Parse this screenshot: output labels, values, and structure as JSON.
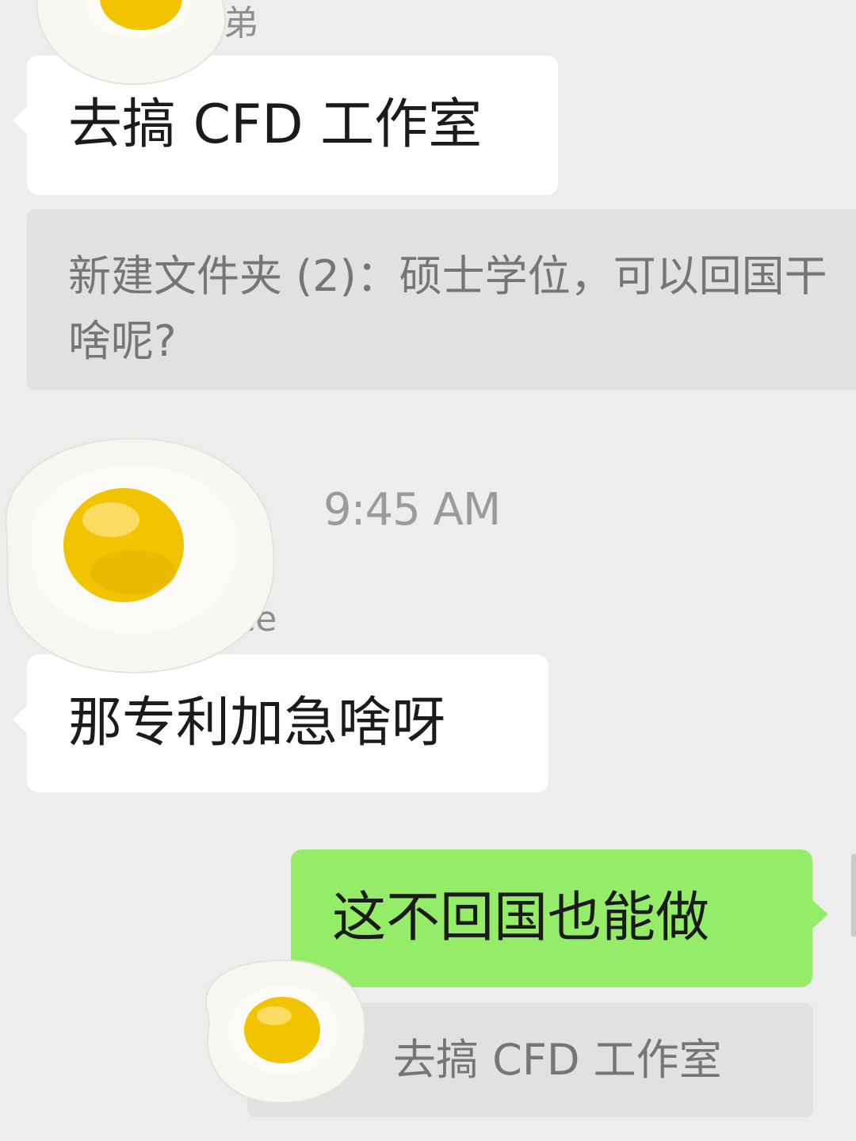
{
  "messages": {
    "m1": {
      "sender_partial": "弟",
      "text": "去搞 CFD 工作室"
    },
    "m1_quote": {
      "text": "新建文件夹 (2)：硕士学位，可以回国干啥呢?"
    },
    "timestamp": "9:45 AM",
    "m2": {
      "sender_partial": "ce",
      "text": "那专利加急啥呀"
    },
    "m3": {
      "text": "这不回国也能做"
    },
    "m3_quote": {
      "text": "去搞 CFD 工作室"
    }
  },
  "colors": {
    "background": "#ededed",
    "incoming_bubble": "#ffffff",
    "outgoing_bubble": "#95ec69",
    "quote_block": "#e1e1e1",
    "egg_yolk": "#f2c300",
    "egg_white": "#f7f6f1"
  },
  "overlays": {
    "sticker": "fried-egg-sticker"
  }
}
